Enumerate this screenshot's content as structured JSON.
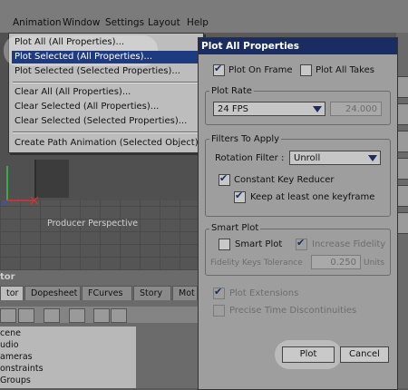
{
  "menubar": {
    "items": [
      "Animation",
      "Window",
      "Settings",
      "Layout",
      "Help"
    ]
  },
  "animation_menu": {
    "items": [
      "Plot All (All Properties)...",
      "Plot Selected (All Properties)...",
      "Plot Selected (Selected Properties)...",
      "Clear All (All Properties)...",
      "Clear Selected (All Properties)...",
      "Clear Selected (Selected Properties)...",
      "Create Path Animation (Selected Object)"
    ],
    "highlighted_index": 1
  },
  "viewport": {
    "label": "Producer Perspective"
  },
  "lower_panel": {
    "title": "tor",
    "tabs": [
      "tor",
      "Dopesheet",
      "FCurves",
      "Story",
      "Mot"
    ],
    "tree": [
      "cene",
      "udio",
      "ameras",
      "onstraints",
      "Groups"
    ]
  },
  "dialog": {
    "title": "Plot All Properties",
    "plot_on_frame": "Plot On Frame",
    "plot_all_takes": "Plot All Takes",
    "plot_rate_label": "Plot Rate",
    "plot_rate_value": "24 FPS",
    "plot_rate_number": "24.000",
    "filters_label": "Filters To Apply",
    "rotation_filter_label": "Rotation Filter :",
    "rotation_filter_value": "Unroll",
    "constant_key_reducer": "Constant Key Reducer",
    "keep_keyframe": "Keep at least one keyframe",
    "smart_plot_label": "Smart Plot",
    "smart_plot": "Smart Plot",
    "increase_fidelity": "Increase Fidelity",
    "fidelity_label": "Fidelity Keys Tolerance",
    "fidelity_value": "0.250",
    "fidelity_units": "Units",
    "plot_extensions": "Plot Extensions",
    "precise_time": "Precise Time Discontinuities",
    "plot_button": "Plot",
    "cancel_button": "Cancel"
  },
  "colors": {
    "menu_highlight": "#1e3b82",
    "dialog_title": "#1a2d62"
  }
}
